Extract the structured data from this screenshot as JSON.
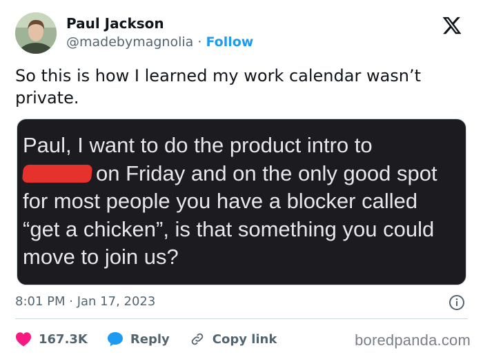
{
  "author": {
    "name": "Paul Jackson",
    "handle": "@madebymagnolia",
    "separator": "·",
    "follow_label": "Follow"
  },
  "tweet": {
    "text": "So this is how I learned my work calendar wasn’t private.",
    "timestamp": "8:01 PM · Jan 17, 2023"
  },
  "media": {
    "line1": "Paul, I want to do the product intro to",
    "line2_after_redaction": "on Friday and on the only good spot",
    "line3": "for most people you have a blocker called",
    "line4": "“get a chicken”, is that something you could",
    "line5": "move to join us?"
  },
  "actions": {
    "likes": "167.3K",
    "reply_label": "Reply",
    "copy_link_label": "Copy link"
  },
  "watermark": "boredpanda.com",
  "colors": {
    "accent": "#1d9bf0",
    "like": "#f91880",
    "muted": "#536471",
    "media_bg": "#1c1c20",
    "redaction": "#e5322d"
  },
  "icons": [
    "x-logo-icon",
    "info-icon",
    "heart-icon",
    "reply-bubble-icon",
    "link-icon"
  ]
}
